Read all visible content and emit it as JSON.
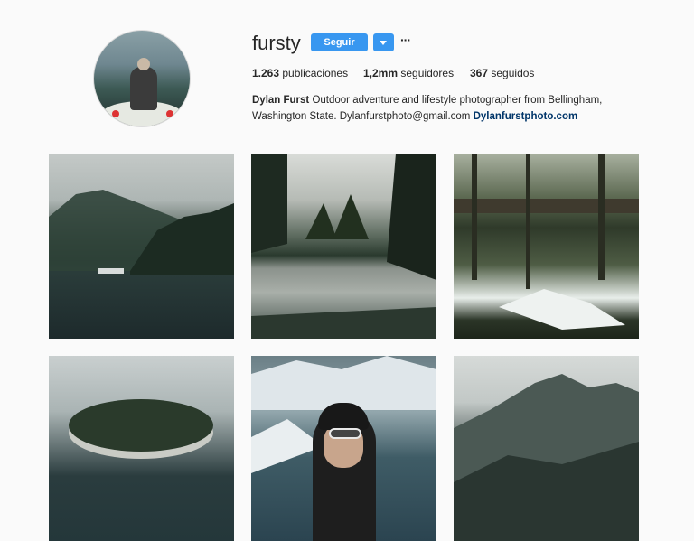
{
  "profile": {
    "username": "fursty",
    "follow_label": "Seguir",
    "more_label": "···",
    "stats": {
      "posts_value": "1.263",
      "posts_label": "publicaciones",
      "followers_value": "1,2mm",
      "followers_label": "seguidores",
      "following_value": "367",
      "following_label": "seguidos"
    },
    "bio": {
      "name": "Dylan Furst",
      "text": " Outdoor adventure and lifestyle photographer from Bellingham, Washington State. Dylanfurstphoto@gmail.com ",
      "link": "Dylanfurstphoto.com"
    }
  },
  "colors": {
    "accent": "#3897f0",
    "link": "#003569",
    "background": "#fafafa"
  },
  "icons": {
    "dropdown": "chevron-down-icon",
    "more": "more-options-icon"
  }
}
